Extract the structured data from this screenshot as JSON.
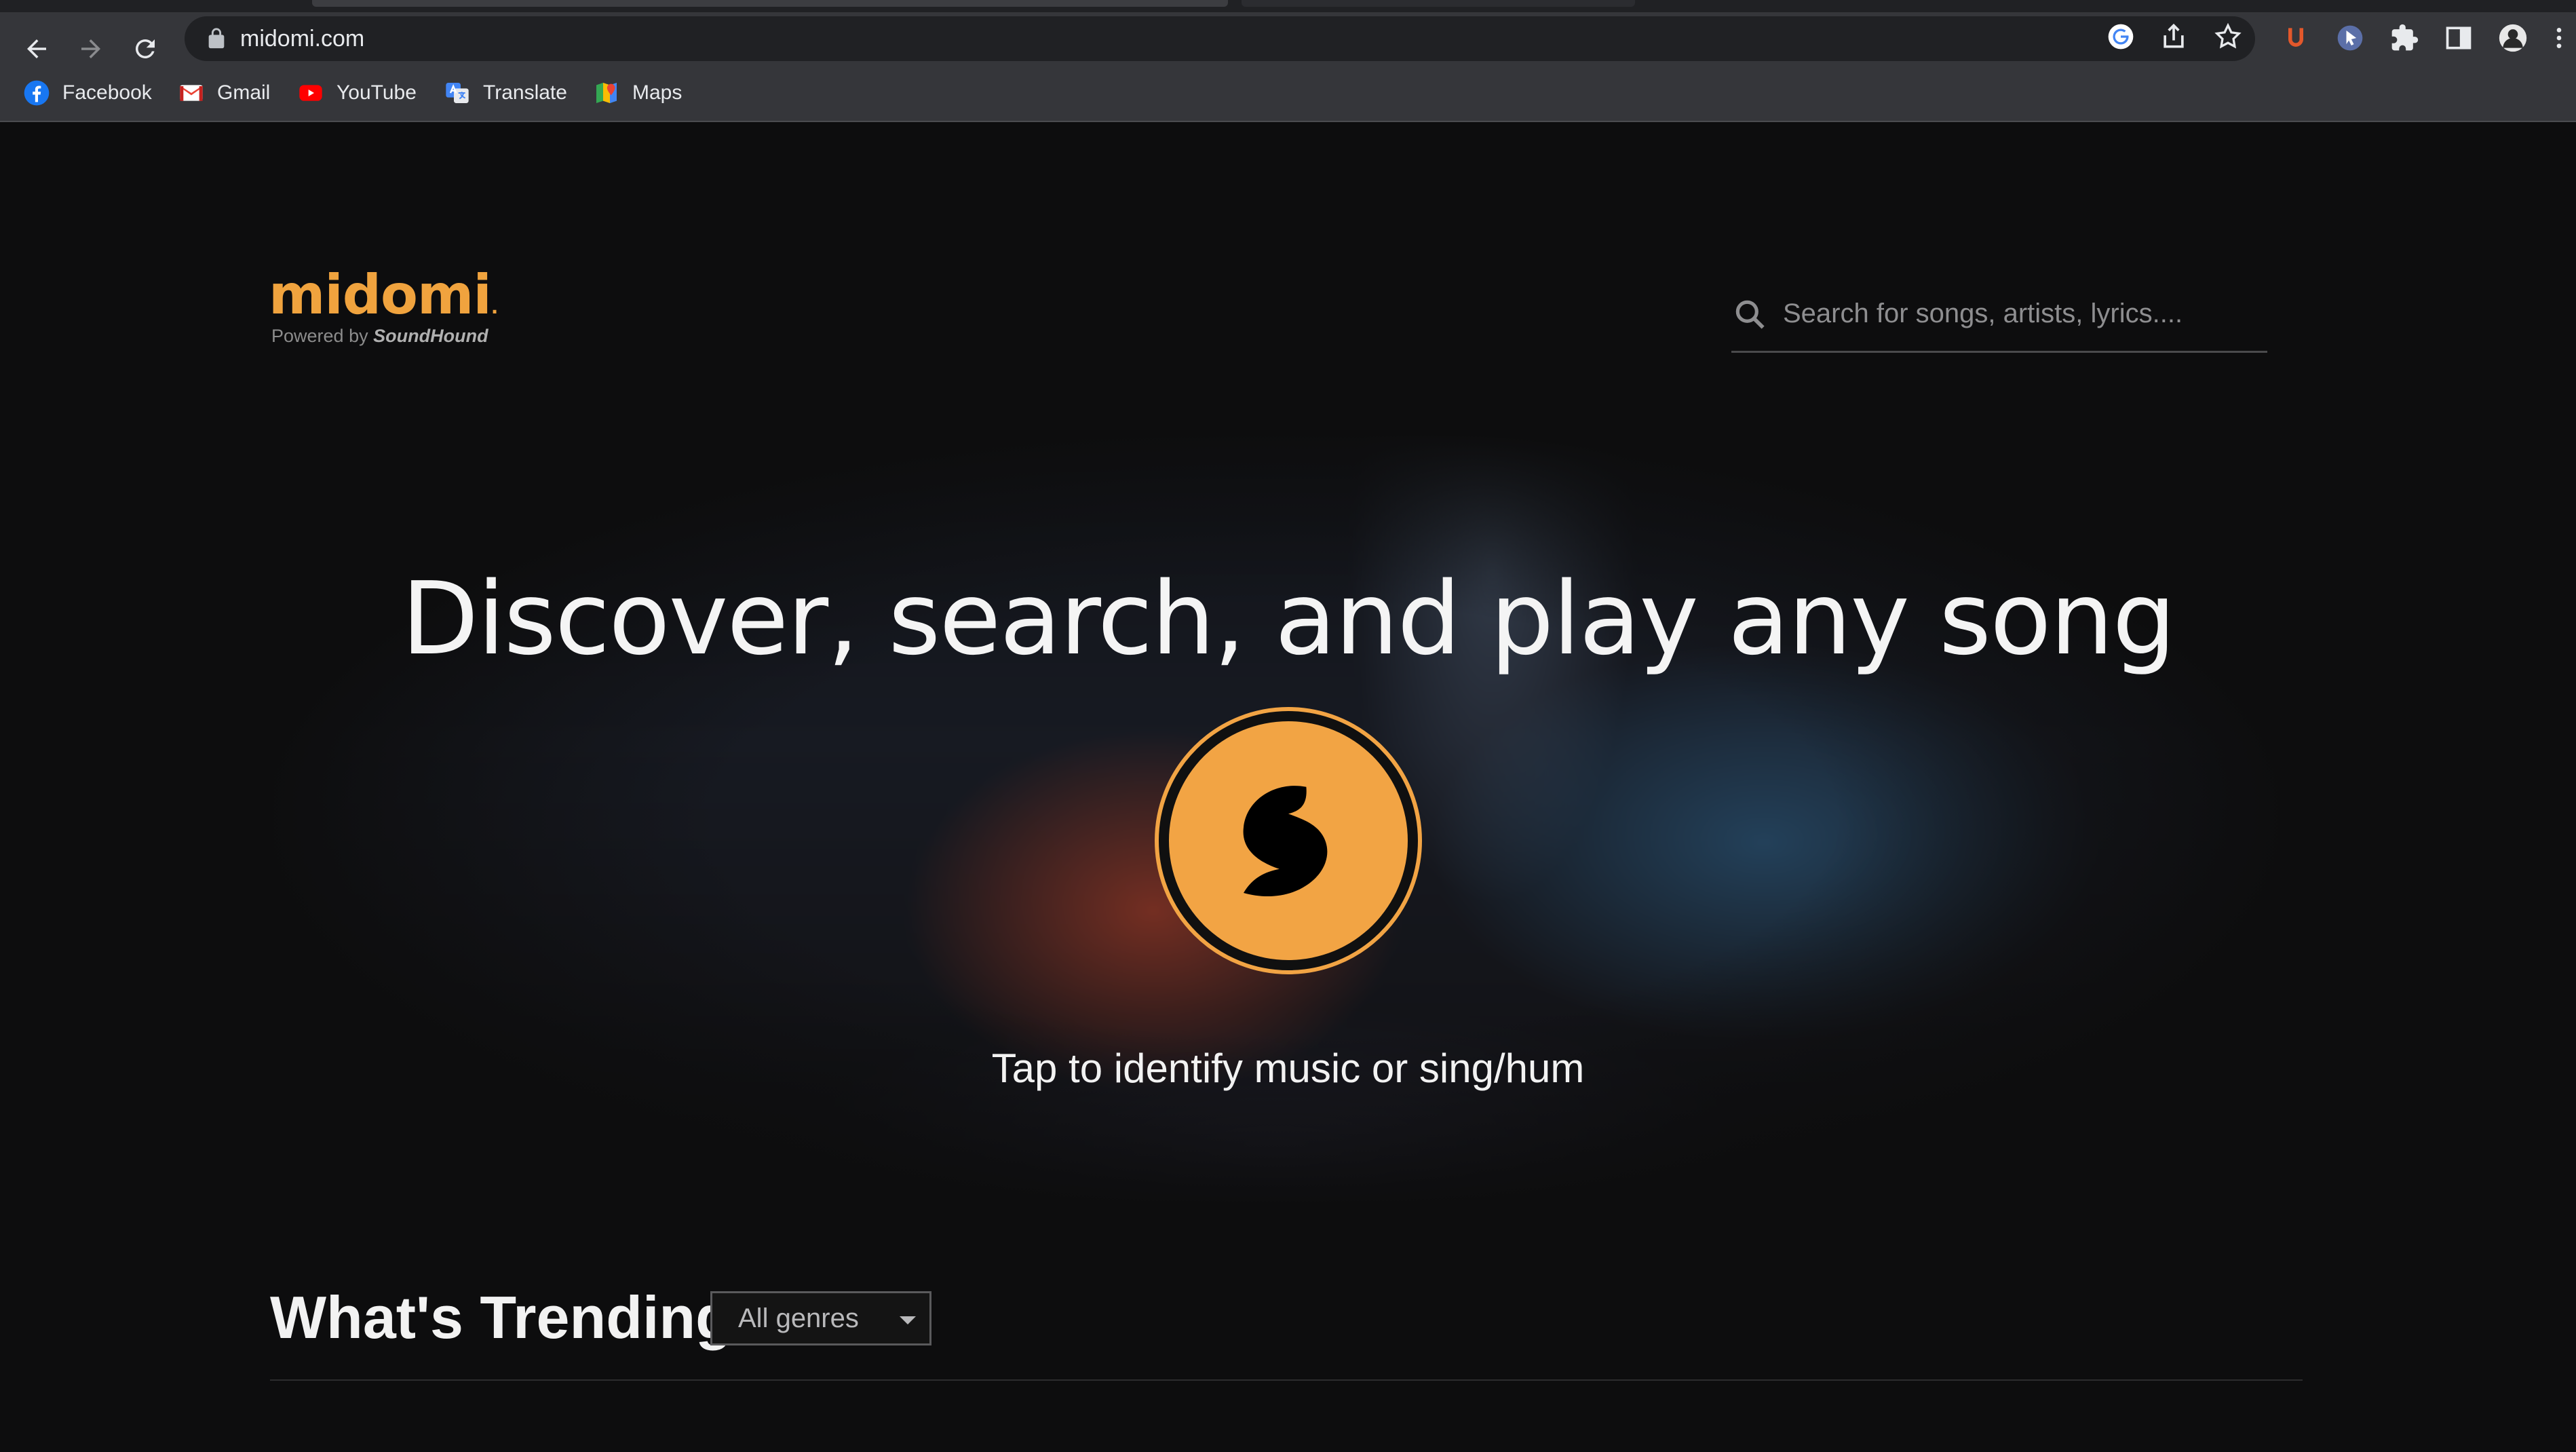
{
  "browser": {
    "url": "midomi.com",
    "bookmarks": [
      {
        "label": "Facebook",
        "icon": "facebook-icon"
      },
      {
        "label": "Gmail",
        "icon": "gmail-icon"
      },
      {
        "label": "YouTube",
        "icon": "youtube-icon"
      },
      {
        "label": "Translate",
        "icon": "translate-icon"
      },
      {
        "label": "Maps",
        "icon": "maps-icon"
      }
    ]
  },
  "site": {
    "logo_text": "midomi",
    "logo_mark": ".",
    "powered_by": "Powered by",
    "powered_brand": "SoundHound",
    "brand_color": "#f2a444"
  },
  "search": {
    "placeholder": "Search for songs, artists, lyrics...."
  },
  "hero": {
    "headline": "Discover, search, and play any song",
    "tap_text": "Tap to identify music or sing/hum"
  },
  "trending": {
    "title": "What's Trending",
    "genre_selected": "All genres"
  }
}
